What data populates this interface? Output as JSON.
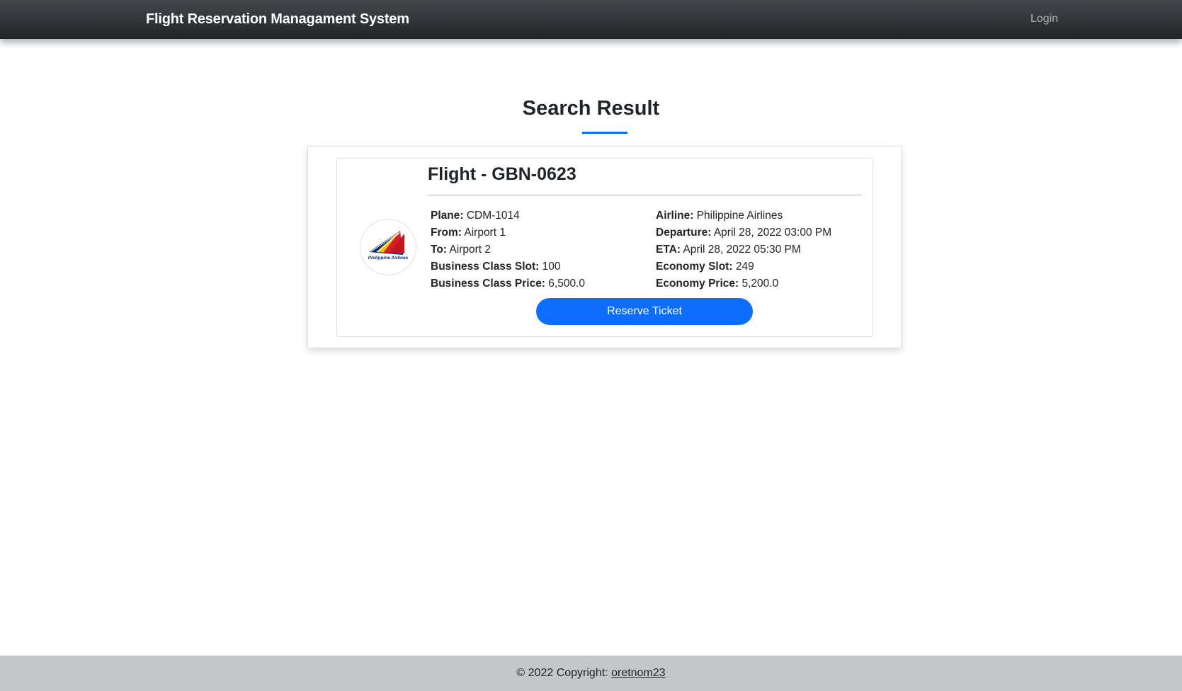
{
  "navbar": {
    "brand": "Flight Reservation Managament System",
    "login_label": "Login"
  },
  "main": {
    "title": "Search Result"
  },
  "flight": {
    "title": "Flight - GBN-0623",
    "logo_text": "Philippine Airlines",
    "left_details": [
      {
        "label": "Plane:",
        "value": "CDM-1014"
      },
      {
        "label": "From:",
        "value": "Airport 1"
      },
      {
        "label": "To:",
        "value": "Airport 2"
      },
      {
        "label": "Business Class Slot:",
        "value": "100"
      },
      {
        "label": "Business Class Price:",
        "value": "6,500.0"
      }
    ],
    "right_details": [
      {
        "label": "Airline:",
        "value": "Philippine Airlines"
      },
      {
        "label": "Departure:",
        "value": "April 28, 2022 03:00 PM"
      },
      {
        "label": "ETA:",
        "value": "April 28, 2022 05:30 PM"
      },
      {
        "label": "Economy Slot:",
        "value": "249"
      },
      {
        "label": "Economy Price:",
        "value": "5,200.0"
      }
    ],
    "reserve_label": "Reserve Ticket"
  },
  "footer": {
    "copyright": "© 2022 Copyright:",
    "author": "oretnom23"
  },
  "colors": {
    "accent": "#0d6efd",
    "navbar": "#2b2e31",
    "footer": "#c4c6c8"
  }
}
